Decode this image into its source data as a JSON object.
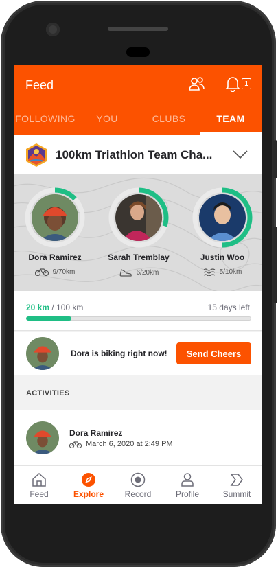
{
  "app": {
    "accent": "#fc5200",
    "success": "#1fbe85"
  },
  "header": {
    "title": "Feed",
    "notification_count": "1"
  },
  "tabs": [
    {
      "label": "FOLLOWING"
    },
    {
      "label": "YOU"
    },
    {
      "label": "CLUBS"
    },
    {
      "label": "TEAM",
      "active": true
    }
  ],
  "challenge": {
    "title": "100km Triathlon Team Cha..."
  },
  "members": [
    {
      "name": "Dora Ramirez",
      "sport_icon": "bike-icon",
      "stat": "9/70km",
      "progress": 0.13
    },
    {
      "name": "Sarah Tremblay",
      "sport_icon": "shoe-icon",
      "stat": "6/20km",
      "progress": 0.3
    },
    {
      "name": "Justin Woo",
      "sport_icon": "swim-icon",
      "stat": "5/10km",
      "progress": 0.5
    }
  ],
  "team_progress": {
    "current": "20 km",
    "separator": " / ",
    "total": "100 km",
    "fraction": 0.2,
    "days_left": "15 days left"
  },
  "live": {
    "text": "Dora is biking right now!",
    "button": "Send Cheers"
  },
  "activities": {
    "header": "ACTIVITIES",
    "items": [
      {
        "name": "Dora Ramirez",
        "date": "March 6, 2020 at 2:49 PM"
      }
    ]
  },
  "nav": [
    {
      "label": "Feed",
      "icon": "home-icon"
    },
    {
      "label": "Explore",
      "icon": "compass-icon",
      "active": true
    },
    {
      "label": "Record",
      "icon": "record-icon"
    },
    {
      "label": "Profile",
      "icon": "profile-icon"
    },
    {
      "label": "Summit",
      "icon": "summit-icon"
    }
  ]
}
